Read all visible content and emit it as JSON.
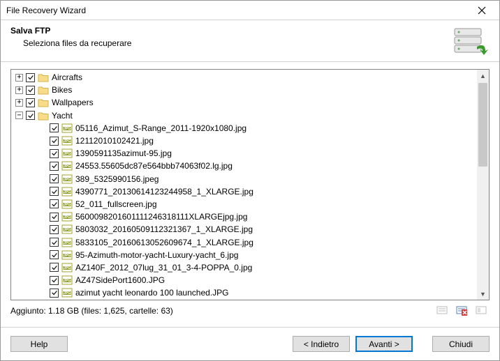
{
  "window": {
    "title": "File Recovery Wizard"
  },
  "header": {
    "title": "Salva FTP",
    "subtitle": "Seleziona files da recuperare"
  },
  "tree": {
    "folders": [
      {
        "expander": "+",
        "name": "Aircrafts"
      },
      {
        "expander": "+",
        "name": "Bikes"
      },
      {
        "expander": "+",
        "name": "Wallpapers"
      },
      {
        "expander": "-",
        "name": "Yacht"
      }
    ],
    "files": [
      "05116_Azimut_S-Range_2011-1920x1080.jpg",
      "12112010102421.jpg",
      "1390591135azimut-95.jpg",
      "24553.55605dc87e564bbb74063f02.lg.jpg",
      "389_5325990156.jpeg",
      "4390771_20130614123244958_1_XLARGE.jpg",
      "52_011_fullscreen.jpg",
      "5600098201601111246318111XLARGEjpg.jpg",
      "5803032_20160509112321367_1_XLARGE.jpg",
      "5833105_20160613052609674_1_XLARGE.jpg",
      "95-Azimuth-motor-yacht-Luxury-yacht_6.jpg",
      "AZ140F_2012_07lug_31_01_3-4-POPPA_0.jpg",
      "AZ47SidePort1600.JPG",
      "azimut yacht leonardo 100 launched.JPG"
    ]
  },
  "status": {
    "text": "Aggiunto: 1.18 GB (files: 1,625, cartelle: 63)"
  },
  "buttons": {
    "help": "Help",
    "back": "< Indietro",
    "next": "Avanti >",
    "close": "Chiudi"
  }
}
